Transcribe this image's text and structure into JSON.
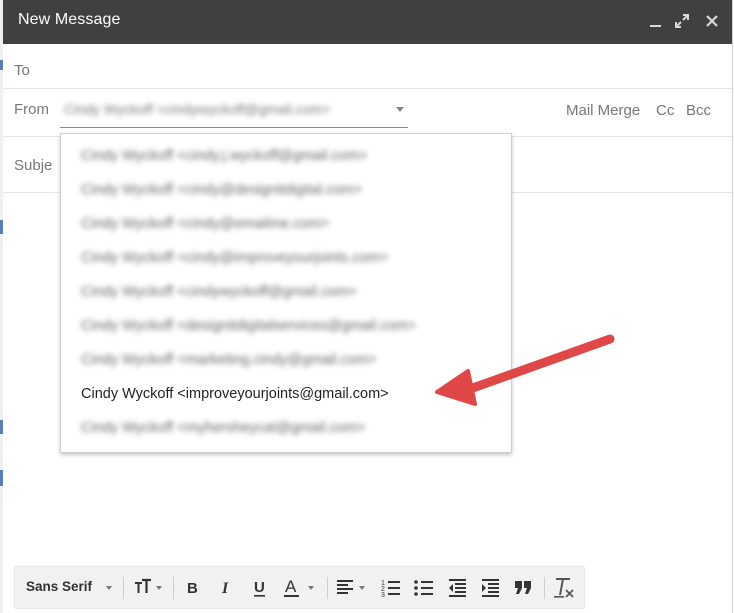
{
  "window": {
    "title": "New Message"
  },
  "window_controls": {
    "minimize": "minimize-icon",
    "expand": "expand-icon",
    "close": "close-icon"
  },
  "fields": {
    "to_label": "To",
    "from_label": "From",
    "subject_label": "Subje",
    "from_value": "Cindy Wyckoff <cindywyckoff@gmail.com>"
  },
  "links": {
    "mail_merge": "Mail Merge",
    "cc": "Cc",
    "bcc": "Bcc"
  },
  "from_dropdown": {
    "items": [
      {
        "label": "Cindy Wyckoff <cindy.j.wyckoff@gmail.com>",
        "blurred": true
      },
      {
        "label": "Cindy Wyckoff <cindy@designitdigital.com>",
        "blurred": true
      },
      {
        "label": "Cindy Wyckoff <cindy@emailme.com>",
        "blurred": true
      },
      {
        "label": "Cindy Wyckoff <cindy@improveyourjoints.com>",
        "blurred": true
      },
      {
        "label": "Cindy Wyckoff <cindywyckoff@gmail.com>",
        "blurred": true
      },
      {
        "label": "Cindy Wyckoff <designitdigitalservices@gmail.com>",
        "blurred": true
      },
      {
        "label": "Cindy Wyckoff <marketing.cindy@gmail.com>",
        "blurred": true
      },
      {
        "label": "Cindy Wyckoff <improveyourjoints@gmail.com>",
        "blurred": false
      },
      {
        "label": "Cindy Wyckoff <myhersheycat@gmail.com>",
        "blurred": true
      }
    ]
  },
  "annotation": {
    "color": "#e04848",
    "points_to": "Cindy Wyckoff <improveyourjoints@gmail.com>"
  },
  "toolbar": {
    "font_family": "Sans Serif",
    "tools": [
      "font-size-icon",
      "bold-icon",
      "italic-icon",
      "underline-icon",
      "text-color-icon",
      "align-icon",
      "numbered-list-icon",
      "bulleted-list-icon",
      "indent-less-icon",
      "indent-more-icon",
      "quote-icon",
      "remove-formatting-icon"
    ]
  },
  "colors": {
    "titlebar": "#404040",
    "focus_underline": "#4d90fe",
    "arrow": "#e04848"
  }
}
